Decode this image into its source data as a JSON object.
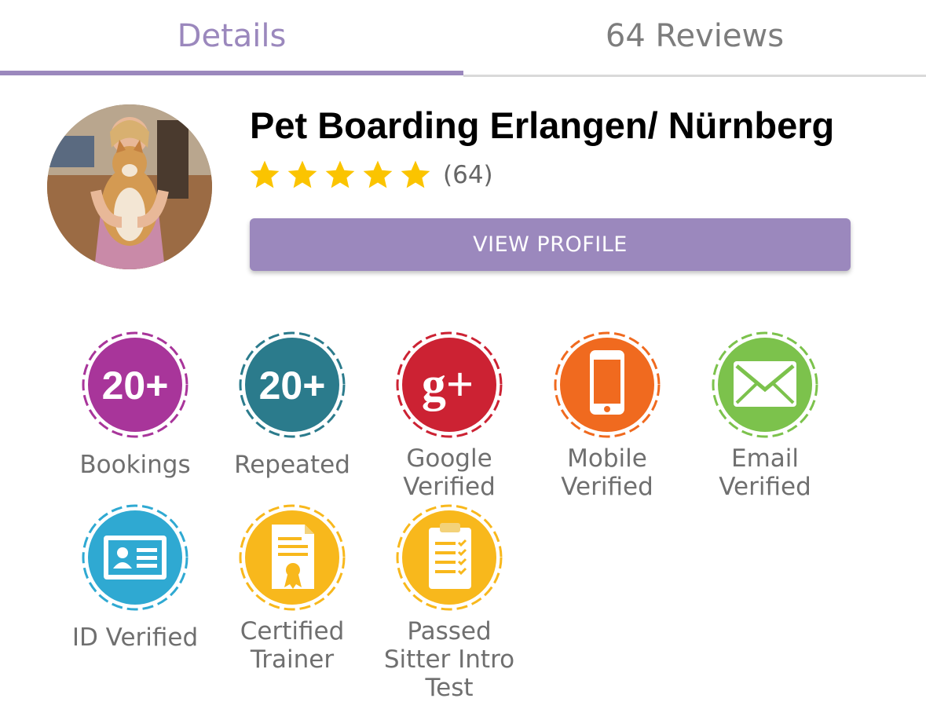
{
  "tabs": [
    {
      "label": "Details",
      "active": true
    },
    {
      "label": "64 Reviews",
      "active": false
    }
  ],
  "profile": {
    "name": "Pet Boarding Erlangen/ Nürnberg",
    "rating_stars": 5,
    "rating_count": "(64)",
    "view_profile_label": "VIEW PROFILE"
  },
  "badges": [
    {
      "icon": "bookings-20-plus-icon",
      "icon_text": "20+",
      "color": "#a8359a",
      "label_lines": [
        "Bookings"
      ]
    },
    {
      "icon": "repeated-20-plus-icon",
      "icon_text": "20+",
      "color": "#2b7b8c",
      "label_lines": [
        "Repeated"
      ]
    },
    {
      "icon": "google-plus-icon",
      "icon_text": "g+",
      "color": "#cc2233",
      "label_lines": [
        "Google",
        "Verified"
      ]
    },
    {
      "icon": "mobile-phone-icon",
      "color": "#f06a1f",
      "label_lines": [
        "Mobile",
        "Verified"
      ]
    },
    {
      "icon": "email-envelope-icon",
      "color": "#7cc24c",
      "label_lines": [
        "Email",
        "Verified"
      ]
    },
    {
      "icon": "id-card-icon",
      "color": "#2fa9d2",
      "label_lines": [
        "ID Verified"
      ]
    },
    {
      "icon": "certificate-icon",
      "color": "#f8b81c",
      "label_lines": [
        "Certified",
        "Trainer"
      ]
    },
    {
      "icon": "clipboard-checklist-icon",
      "color": "#f8b81c",
      "label_lines": [
        "Passed",
        "Sitter Intro",
        "Test"
      ]
    }
  ],
  "colors": {
    "accent": "#9b88bd",
    "star": "#fbc400"
  }
}
